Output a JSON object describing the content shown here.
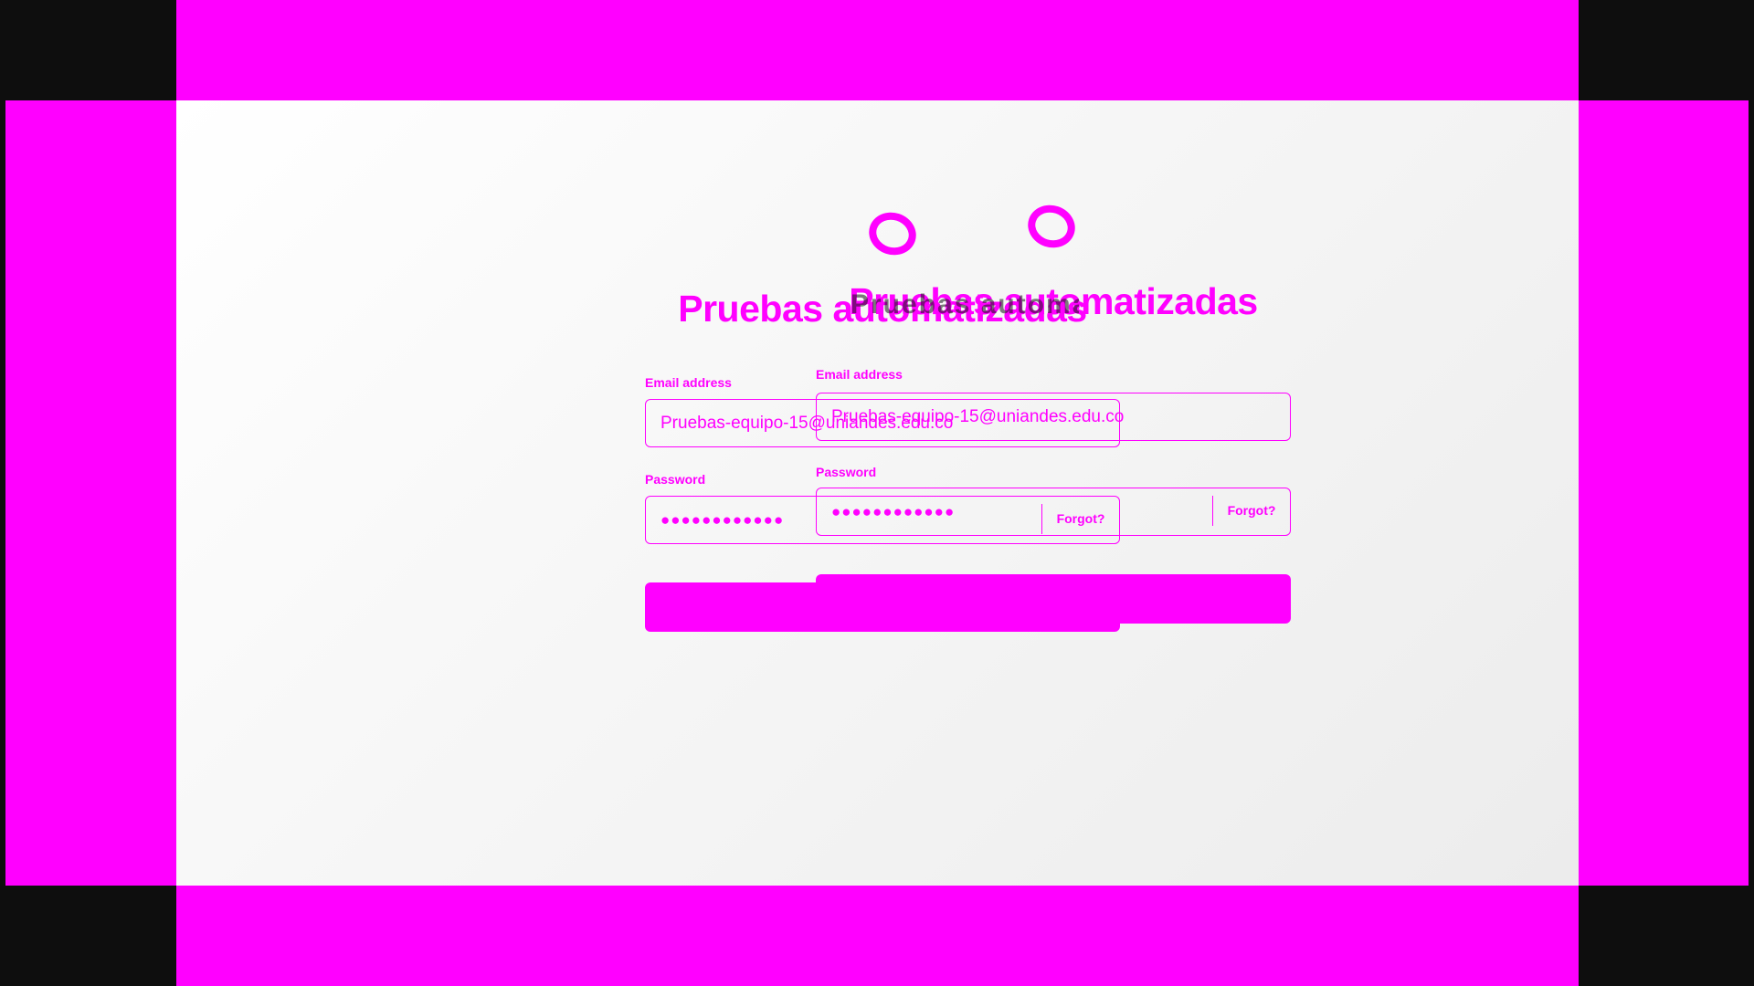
{
  "site_title": "Pruebas automatizadas",
  "login": {
    "email_label": "Email address",
    "email_value": "Pruebas-equipo-15@uniandes.edu.co",
    "password_label": "Password",
    "password_masked": "●●●●●●●●●●●●",
    "forgot_label": "Forgot?",
    "signin_label": ""
  },
  "colors": {
    "accent": "#ff00ff",
    "frame": "#0e0e0e",
    "background": "#f5f5f5"
  },
  "icons": {
    "logo": "ring-logo-icon"
  }
}
